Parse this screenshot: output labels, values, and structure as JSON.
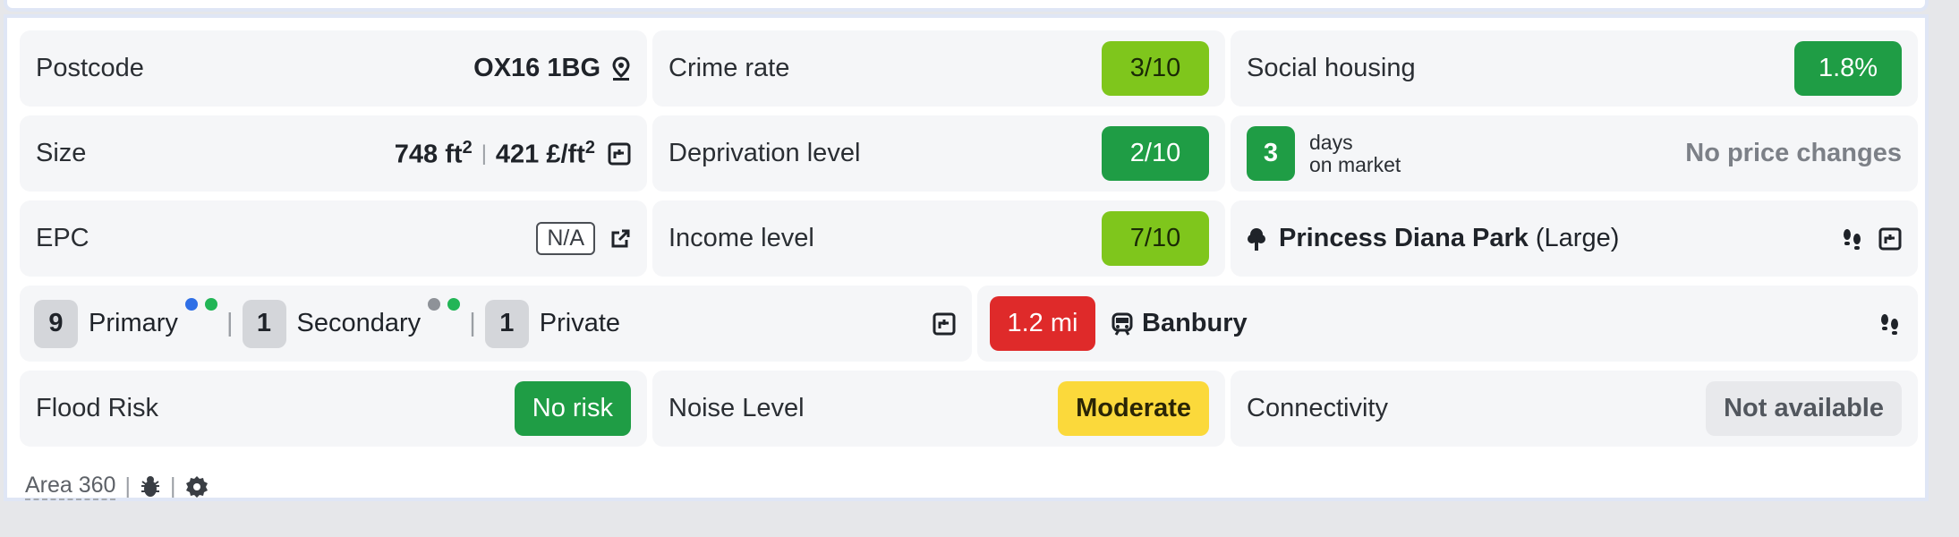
{
  "row1": {
    "postcode": {
      "label": "Postcode",
      "value": "OX16 1BG",
      "icon": "map-pin-icon"
    },
    "crime": {
      "label": "Crime rate",
      "value": "3/10",
      "color": "#7fc61c"
    },
    "social": {
      "label": "Social housing",
      "value": "1.8%",
      "color": "#1f9d45"
    }
  },
  "row2": {
    "size": {
      "label": "Size",
      "area": "748 ft",
      "area_sup": "2",
      "sep": "|",
      "price": "421 £/ft",
      "price_sup": "2",
      "icon": "floorplan-icon"
    },
    "deprivation": {
      "label": "Deprivation level",
      "value": "2/10",
      "color": "#1f9d45"
    },
    "market": {
      "days": "3",
      "days_line1": "days",
      "days_line2": "on market",
      "price_changes": "No price changes"
    }
  },
  "row3": {
    "epc": {
      "label": "EPC",
      "value": "N/A",
      "icon": "external-link-icon"
    },
    "income": {
      "label": "Income level",
      "value": "7/10",
      "color": "#7fc61c"
    },
    "park": {
      "name": "Princess Diana Park",
      "size": "(Large)",
      "icon": "tree-icon"
    }
  },
  "row4": {
    "schools": {
      "primary_count": "9",
      "primary_label": "Primary",
      "secondary_count": "1",
      "secondary_label": "Secondary",
      "private_count": "1",
      "private_label": "Private",
      "sep": "|"
    },
    "station": {
      "distance": "1.2 mi",
      "name": "Banbury",
      "icon": "train-icon"
    }
  },
  "row5": {
    "flood": {
      "label": "Flood Risk",
      "value": "No risk",
      "color": "#1f9d45"
    },
    "noise": {
      "label": "Noise Level",
      "value": "Moderate",
      "color": "#fbd93b"
    },
    "connectivity": {
      "label": "Connectivity",
      "value": "Not available"
    }
  },
  "footer": {
    "brand": "Area 360",
    "sep": "|",
    "icons": [
      "bug-icon",
      "gear-icon"
    ]
  }
}
